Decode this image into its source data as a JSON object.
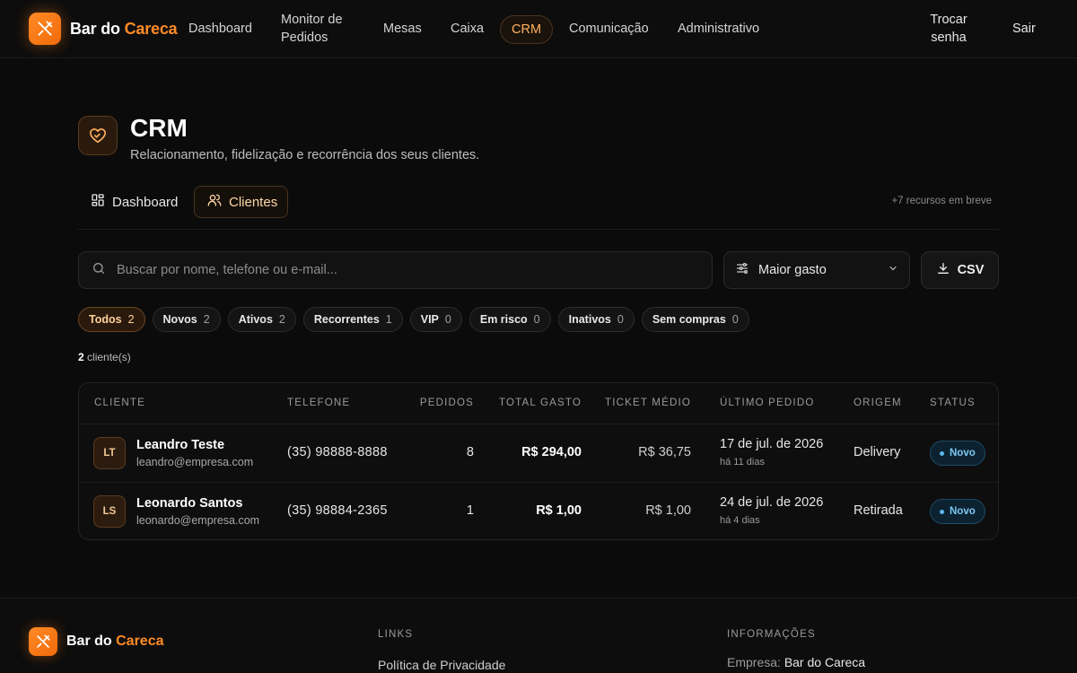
{
  "app": {
    "brand_main": "Bar do",
    "brand_accent": "Careca",
    "accent_color": "#ff8a26"
  },
  "nav": {
    "items": [
      {
        "label": "Dashboard"
      },
      {
        "label_line1": "Monitor de",
        "label_line2": "Pedidos"
      },
      {
        "label": "Mesas"
      },
      {
        "label": "Caixa"
      },
      {
        "label": "CRM",
        "active": true
      },
      {
        "label": "Comunicação"
      },
      {
        "label": "Administrativo"
      }
    ],
    "change_password_line1": "Trocar",
    "change_password_line2": "senha",
    "logout": "Sair"
  },
  "header": {
    "icon": "heart-handshake-icon",
    "title": "CRM",
    "subtitle": "Relacionamento, fidelização e recorrência dos seus clientes."
  },
  "subtabs": {
    "items": [
      {
        "label": "Dashboard",
        "icon": "grid-icon"
      },
      {
        "label": "Clientes",
        "icon": "users-icon",
        "active": true
      }
    ],
    "coming_soon": "+7 recursos em breve"
  },
  "search": {
    "placeholder": "Buscar por nome, telefone ou e-mail...",
    "value": ""
  },
  "sort": {
    "selected": "Maior gasto"
  },
  "export": {
    "label": "CSV"
  },
  "filters": [
    {
      "label": "Todos",
      "count": "2",
      "active": true
    },
    {
      "label": "Novos",
      "count": "2"
    },
    {
      "label": "Ativos",
      "count": "2"
    },
    {
      "label": "Recorrentes",
      "count": "1"
    },
    {
      "label": "VIP",
      "count": "0"
    },
    {
      "label": "Em risco",
      "count": "0"
    },
    {
      "label": "Inativos",
      "count": "0"
    },
    {
      "label": "Sem compras",
      "count": "0"
    }
  ],
  "result_count": {
    "number": "2",
    "label": "cliente(s)"
  },
  "table": {
    "headers": [
      "CLIENTE",
      "TELEFONE",
      "PEDIDOS",
      "TOTAL GASTO",
      "TICKET MÉDIO",
      "ÚLTIMO PEDIDO",
      "ORIGEM",
      "STATUS"
    ],
    "rows": [
      {
        "initials": "LT",
        "name": "Leandro Teste",
        "email": "leandro@empresa.com",
        "phone": "(35) 98888-8888",
        "orders": "8",
        "total": "R$ 294,00",
        "ticket": "R$ 36,75",
        "last_date": "17 de jul. de 2026",
        "last_ago": "há 11 dias",
        "origin": "Delivery",
        "status": "Novo"
      },
      {
        "initials": "LS",
        "name": "Leonardo Santos",
        "email": "leonardo@empresa.com",
        "phone": "(35) 98884-2365",
        "orders": "1",
        "total": "R$ 1,00",
        "ticket": "R$ 1,00",
        "last_date": "24 de jul. de 2026",
        "last_ago": "há 4 dias",
        "origin": "Retirada",
        "status": "Novo"
      }
    ]
  },
  "footer": {
    "brand_main": "Bar do",
    "brand_accent": "Careca",
    "links_heading": "LINKS",
    "privacy_link": "Política de Privacidade",
    "info_heading": "INFORMAÇÕES",
    "company_label": "Empresa:",
    "company_value": "Bar do Careca"
  }
}
